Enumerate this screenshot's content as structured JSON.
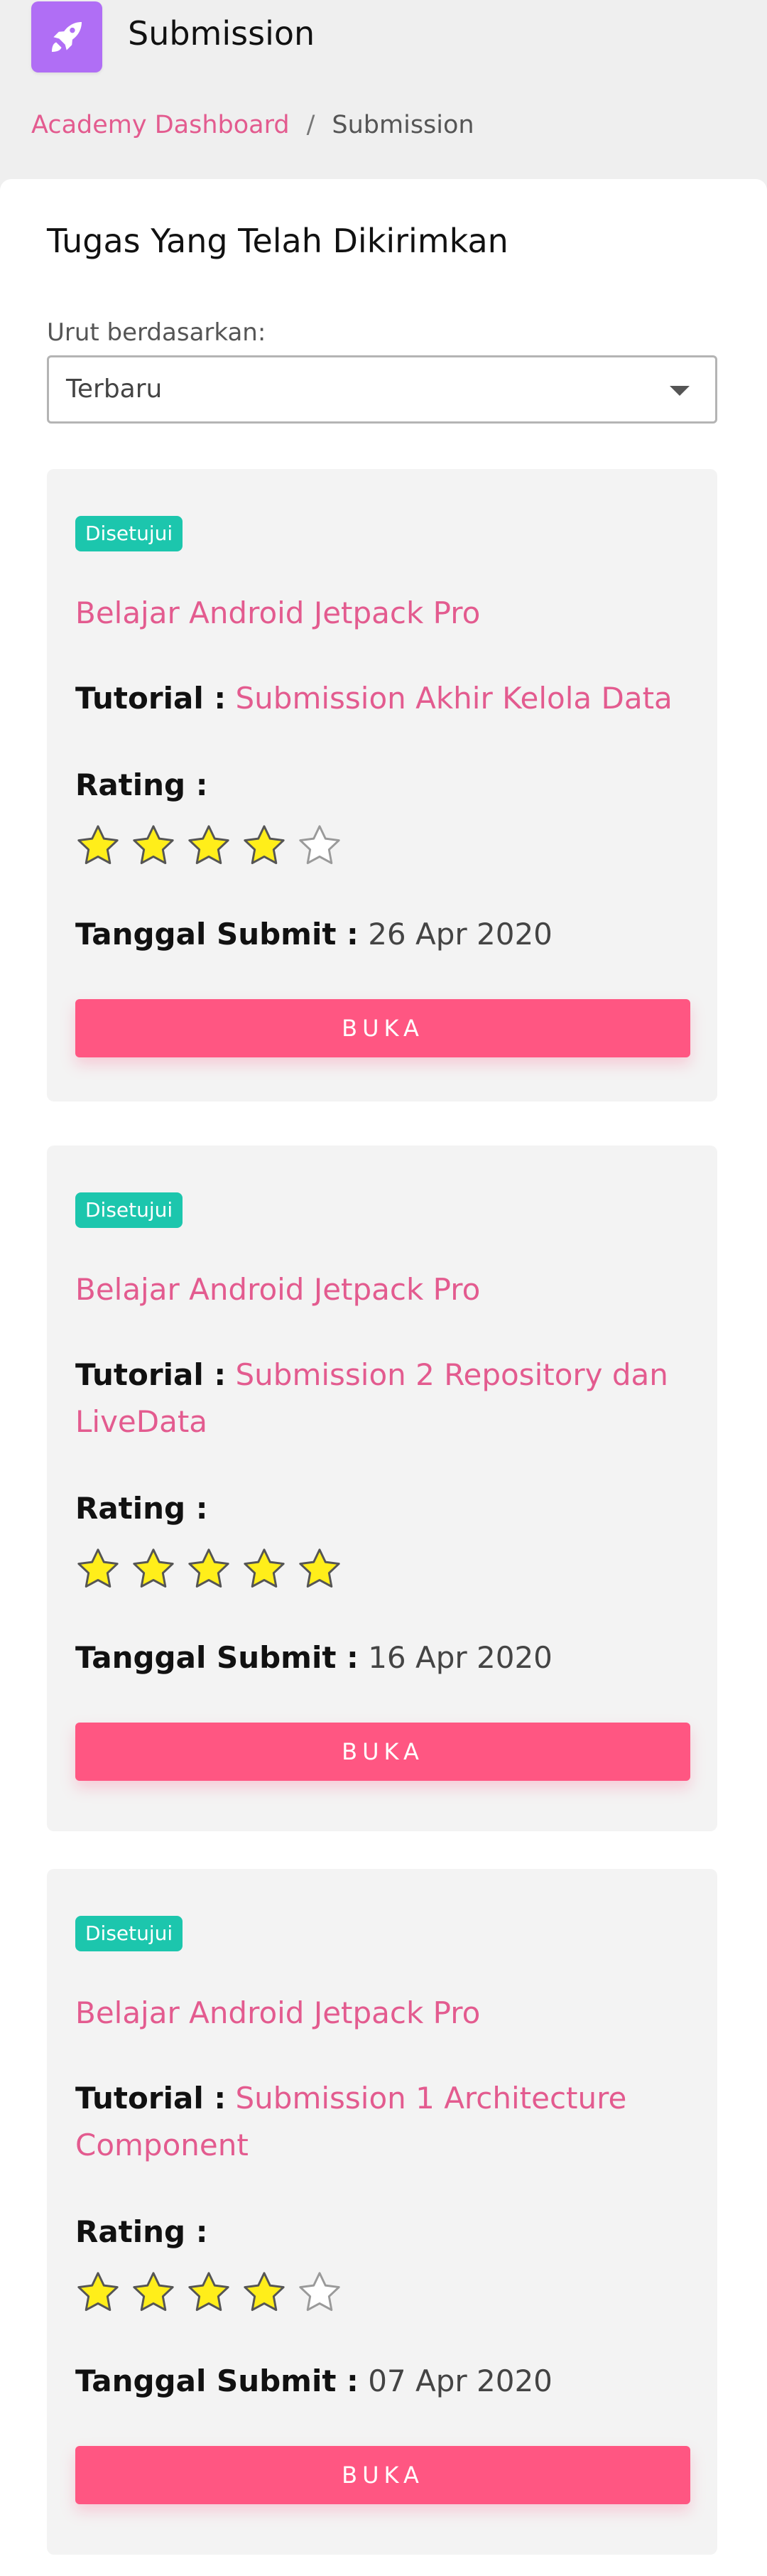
{
  "app": {
    "title": "Submission",
    "icon": "rocket-icon",
    "accent": "#b06ef5"
  },
  "breadcrumb": {
    "home": "Academy Dashboard",
    "separator": "/",
    "current": "Submission"
  },
  "main": {
    "title": "Tugas Yang Telah Dikirimkan",
    "sort": {
      "label": "Urut berdasarkan:",
      "selected": "Terbaru"
    }
  },
  "colors": {
    "link": "#e35b8f",
    "badge": "#1cc6ad",
    "button": "#ff5682",
    "star_fill": "#ffee1a"
  },
  "submissions": [
    {
      "status": "Disetujui",
      "course": "Belajar Android Jetpack Pro",
      "tutorial_label": "Tutorial :",
      "tutorial": "Submission Akhir Kelola Data",
      "rating_label": "Rating :",
      "rating": 4,
      "rating_max": 5,
      "date_label": "Tanggal Submit :",
      "date": "26 Apr 2020",
      "button": "BUKA"
    },
    {
      "status": "Disetujui",
      "course": "Belajar Android Jetpack Pro",
      "tutorial_label": "Tutorial :",
      "tutorial": "Submission 2 Repository dan LiveData",
      "rating_label": "Rating :",
      "rating": 5,
      "rating_max": 5,
      "date_label": "Tanggal Submit :",
      "date": "16 Apr 2020",
      "button": "BUKA"
    },
    {
      "status": "Disetujui",
      "course": "Belajar Android Jetpack Pro",
      "tutorial_label": "Tutorial :",
      "tutorial": "Submission 1 Architecture Component",
      "rating_label": "Rating :",
      "rating": 4,
      "rating_max": 5,
      "date_label": "Tanggal Submit :",
      "date": "07 Apr 2020",
      "button": "BUKA"
    }
  ]
}
